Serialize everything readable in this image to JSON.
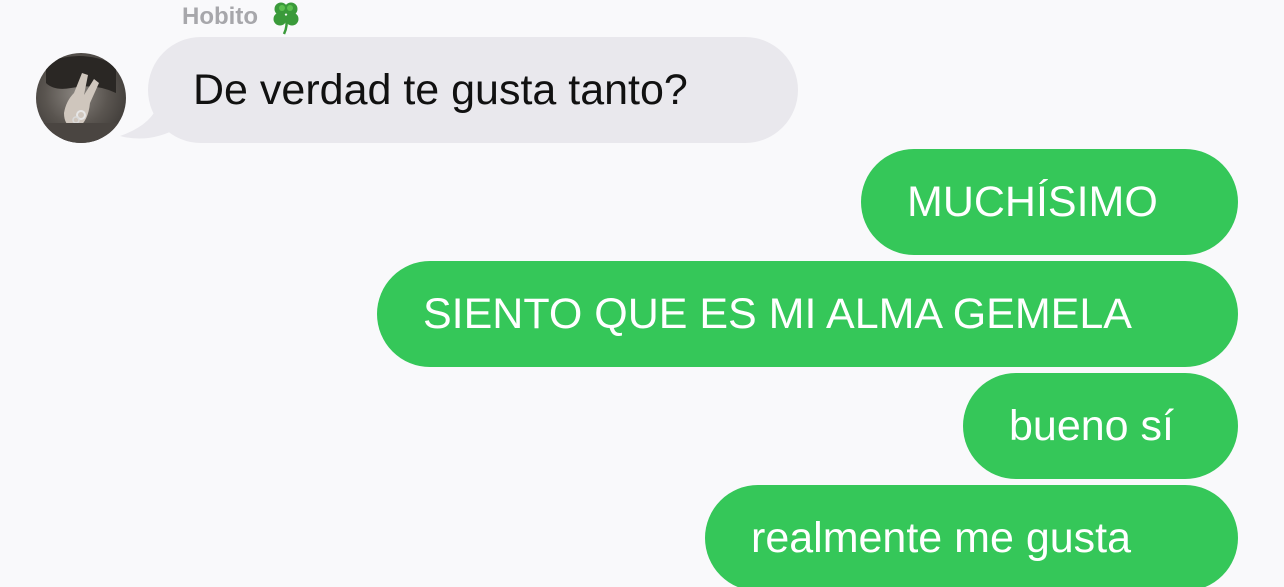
{
  "chat": {
    "sender_name": "Hobito",
    "sender_emoji_icon": "four-leaf-clover-icon",
    "incoming_messages": [
      {
        "text": "De verdad te gusta tanto?"
      }
    ],
    "outgoing_messages": [
      {
        "text": "MUCHÍSIMO"
      },
      {
        "text": "SIENTO QUE ES MI ALMA GEMELA"
      },
      {
        "text": "bueno sí"
      },
      {
        "text": "realmente me gusta"
      }
    ]
  },
  "colors": {
    "background": "#f9f9fb",
    "incoming_bubble": "#e9e8ed",
    "outgoing_bubble": "#35c759",
    "sender_name": "#a7a7ab",
    "clover": "#3a9a3a"
  }
}
